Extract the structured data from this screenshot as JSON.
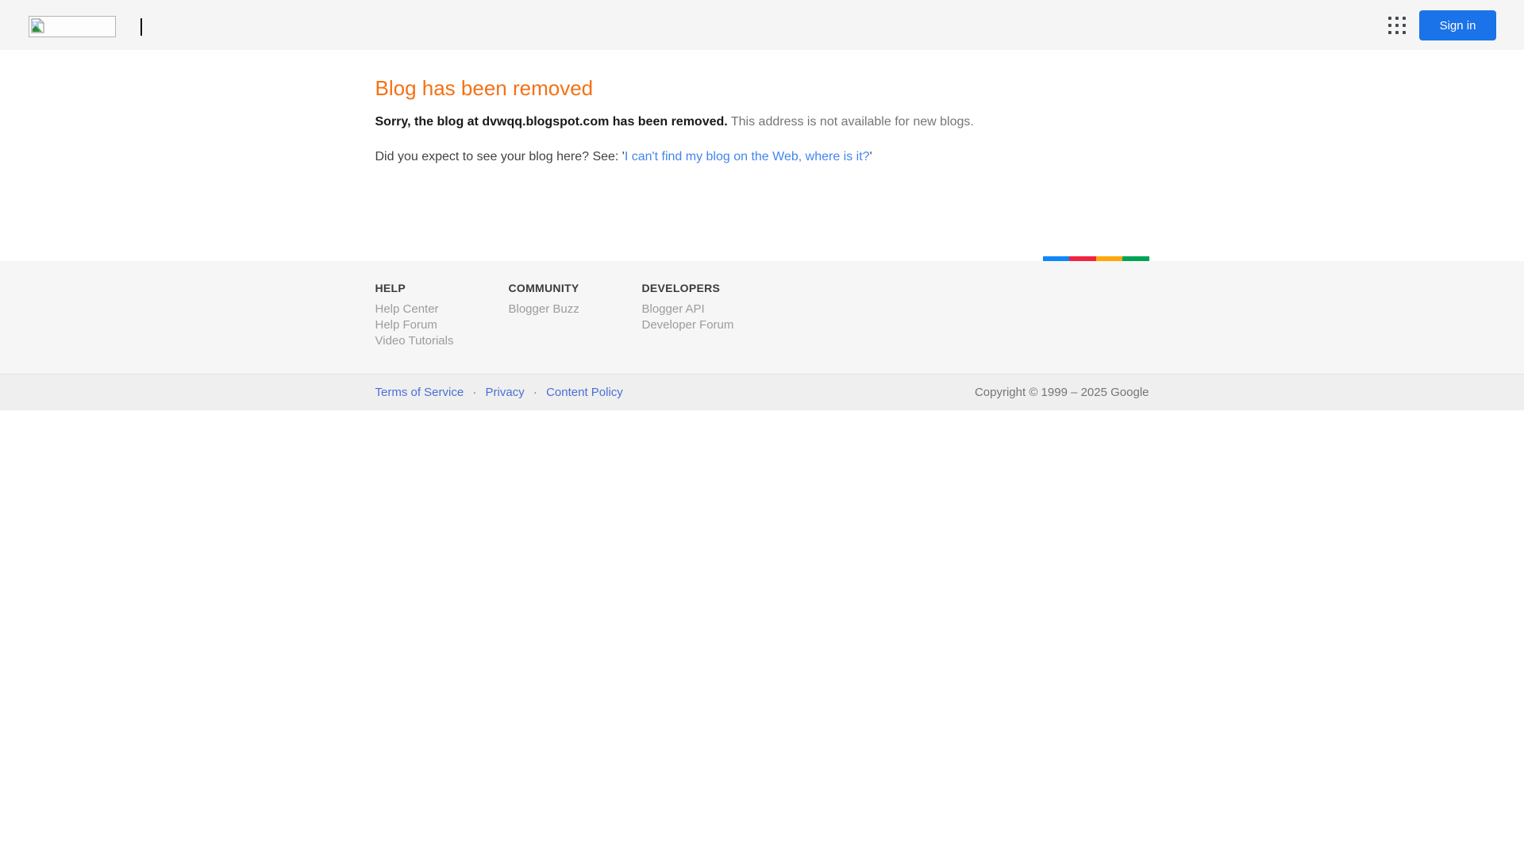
{
  "header": {
    "sign_in_label": "Sign in",
    "icons": {
      "logo": "broken-image-icon",
      "apps": "apps-grid-icon"
    },
    "colors": {
      "header_bg": "#f5f5f5",
      "sign_in_bg": "#1a73e8",
      "sign_in_text": "#ffffff",
      "apps_icon": "#454a50"
    }
  },
  "main": {
    "title": "Blog has been removed",
    "message_bold": "Sorry, the blog at dvwqq.blogspot.com has been removed.",
    "message_rest": "This address is not available for new blogs.",
    "expect_prefix": "Did you expect to see your blog here? See: '",
    "expect_link": "I can't find my blog on the Web, where is it?",
    "expect_suffix": "'",
    "colors": {
      "title_orange": "#f47115",
      "message_bold": "#191919",
      "message_rest": "#757575",
      "expect_text": "#424242",
      "link_blue": "#4385f0"
    }
  },
  "rainbow_bar": {
    "colors": [
      "#0e87f8",
      "#f0243e",
      "#fda70c",
      "#00a355"
    ]
  },
  "footer": {
    "columns": [
      {
        "heading": "HELP",
        "links": [
          "Help Center",
          "Help Forum",
          "Video Tutorials"
        ]
      },
      {
        "heading": "COMMUNITY",
        "links": [
          "Blogger Buzz"
        ]
      },
      {
        "heading": "DEVELOPERS",
        "links": [
          "Blogger API",
          "Developer Forum"
        ]
      }
    ],
    "bottom": {
      "links": [
        "Terms of Service",
        "Privacy",
        "Content Policy"
      ],
      "separator": "·",
      "copyright": "Copyright © 1999 – 2025 Google",
      "colors": {
        "footer_bg": "#f6f6f6",
        "bottom_bg": "#efefef",
        "link_blue": "#4a70d4",
        "muted_text": "#757575"
      }
    }
  }
}
